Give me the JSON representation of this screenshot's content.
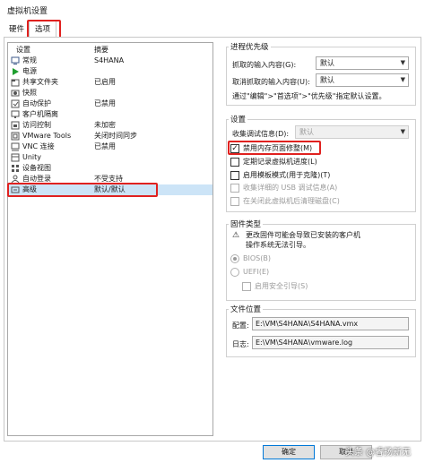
{
  "window": {
    "title": "虚拟机设置"
  },
  "tabs": [
    {
      "label": "硬件"
    },
    {
      "label": "选项"
    }
  ],
  "device_list": {
    "headers": {
      "setting": "设置",
      "summary": "摘要"
    },
    "rows": [
      {
        "icon": "display-icon",
        "name": "常规",
        "summary": "S4HANA"
      },
      {
        "icon": "play-icon",
        "name": "电源",
        "summary": ""
      },
      {
        "icon": "folder-icon",
        "name": "共享文件夹",
        "summary": "已启用"
      },
      {
        "icon": "snapshot-icon",
        "name": "快照",
        "summary": ""
      },
      {
        "icon": "shield-icon",
        "name": "自动保护",
        "summary": "已禁用"
      },
      {
        "icon": "monitor-icon",
        "name": "客户机隔离",
        "summary": ""
      },
      {
        "icon": "lock-icon",
        "name": "访问控制",
        "summary": "未加密"
      },
      {
        "icon": "vmware-icon",
        "name": "VMware Tools",
        "summary": "关闭时间同步"
      },
      {
        "icon": "vnc-icon",
        "name": "VNC 连接",
        "summary": "已禁用"
      },
      {
        "icon": "unity-icon",
        "name": "Unity",
        "summary": ""
      },
      {
        "icon": "device-view-icon",
        "name": "设备视图",
        "summary": ""
      },
      {
        "icon": "login-icon",
        "name": "自动登录",
        "summary": "不受支持"
      },
      {
        "icon": "advanced-icon",
        "name": "高级",
        "summary": "默认/默认"
      }
    ]
  },
  "priority": {
    "title": "进程优先级",
    "grab_label": "抓取的输入内容(G):",
    "grab_value": "默认",
    "ungrab_label": "取消抓取的输入内容(U):",
    "ungrab_value": "默认",
    "hint": "通过\"编辑\">\"首选项\">\"优先级\"指定默认设置。"
  },
  "settings": {
    "title": "设置",
    "debug_label": "收集调试信息(D):",
    "debug_value": "默认",
    "checkboxes": [
      {
        "label": "禁用内存页面修整(M)",
        "checked": "✓"
      },
      {
        "label": "定期记录虚拟机进度(L)",
        "checked": ""
      },
      {
        "label": "启用模板模式(用于克隆)(T)",
        "checked": ""
      },
      {
        "label": "收集详细的 USB 调试信息(A)",
        "checked": ""
      },
      {
        "label": "在关闭此虚拟机后清理磁盘(C)",
        "checked": ""
      }
    ]
  },
  "firmware": {
    "title": "固件类型",
    "warning": "更改固件可能会导致已安装的客户机操作系统无法引导。",
    "warning_line1": "更改固件可能会导致已安装的客户机",
    "warning_line2": "操作系统无法引导。",
    "bios_label": "BIOS(B)",
    "uefi_label": "UEFI(E)",
    "secure_boot_label": "启用安全引导(S)"
  },
  "file_location": {
    "title": "文件位置",
    "config_label": "配置:",
    "config_value": "E:\\VM\\S4HANA\\S4HANA.vmx",
    "log_label": "日志:",
    "log_value": "E:\\VM\\S4HANA\\vmware.log"
  },
  "buttons": {
    "ok": "确定",
    "cancel": "取消"
  },
  "watermark": "头条 @睿扬新无"
}
